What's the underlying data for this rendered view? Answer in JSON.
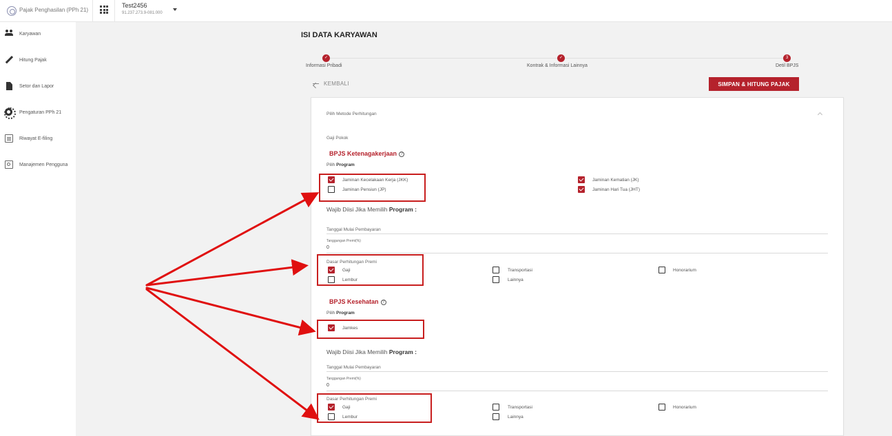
{
  "topbar": {
    "app_name": "Pajak Penghasilan (PPh 21)",
    "company_name": "Test2456",
    "company_npwp": "91.237.273.9-081.000"
  },
  "sidebar": {
    "items": [
      {
        "label": "Karyawan",
        "icon": "people-icon"
      },
      {
        "label": "Hitung Pajak",
        "icon": "pencil-icon"
      },
      {
        "label": "Setor dan Lapor",
        "icon": "document-icon"
      },
      {
        "label": "Pengaturan PPh 21",
        "icon": "gear-icon"
      },
      {
        "label": "Riwayat E-filing",
        "icon": "efiling-icon"
      },
      {
        "label": "Manajemen Pengguna",
        "icon": "users-icon"
      }
    ]
  },
  "main": {
    "title": "ISI DATA KARYAWAN",
    "steps": [
      {
        "label": "Informasi Pribadi",
        "done": true
      },
      {
        "label": "Kontrak & Informasi Lainnya",
        "done": true
      },
      {
        "label": "Detil BPJS",
        "number": "3"
      }
    ],
    "back_label": "KEMBALI",
    "save_label": "SIMPAN & HITUNG PAJAK"
  },
  "form": {
    "metode_label": "Pilih Metode Perhitungan",
    "gaji_pokok_label": "Gaji Pokok",
    "ketenagakerjaan": {
      "title": "BPJS Ketenagakerjaan",
      "pilih_label": "Pilih",
      "program_label": "Program",
      "programs": [
        {
          "label": "Jaminan Kecelakaan Kerja (JKK)",
          "checked": true
        },
        {
          "label": "Jaminan Pensiun (JP)",
          "checked": false
        },
        {
          "label": "Jaminan Kematian (JK)",
          "checked": true
        },
        {
          "label": "Jaminan Hari Tua (JHT)",
          "checked": true
        }
      ],
      "wajib_label": "Wajib Diisi Jika Memilih",
      "wajib_bold": "Program :",
      "tanggal_label": "Tanggal Mulai Pembayaran",
      "tanggungan_label": "Tanggungan Premi(%)",
      "tanggungan_value": "0",
      "dasar_label": "Dasar Perhitungan Premi",
      "dasar": [
        {
          "label": "Gaji",
          "checked": true
        },
        {
          "label": "Lembur",
          "checked": false
        },
        {
          "label": "Transportasi",
          "checked": false
        },
        {
          "label": "Lainnya",
          "checked": false
        },
        {
          "label": "Honorarium",
          "checked": false
        }
      ]
    },
    "kesehatan": {
      "title": "BPJS Kesehatan",
      "pilih_label": "Pilih",
      "program_label": "Program",
      "programs": [
        {
          "label": "Jamkes",
          "checked": true
        }
      ],
      "wajib_label": "Wajib Diisi Jika Memilih",
      "wajib_bold": "Program :",
      "tanggal_label": "Tanggal Mulai Pembayaran",
      "tanggungan_label": "Tanggungan Premi(%)",
      "tanggungan_value": "0",
      "dasar_label": "Dasar Perhitungan Premi",
      "dasar": [
        {
          "label": "Gaji",
          "checked": true
        },
        {
          "label": "Lembur",
          "checked": false
        },
        {
          "label": "Transportasi",
          "checked": false
        },
        {
          "label": "Lainnya",
          "checked": false
        },
        {
          "label": "Honorarium",
          "checked": false
        }
      ]
    }
  },
  "colors": {
    "accent": "#b5222c",
    "annotation": "#c81e1e"
  }
}
